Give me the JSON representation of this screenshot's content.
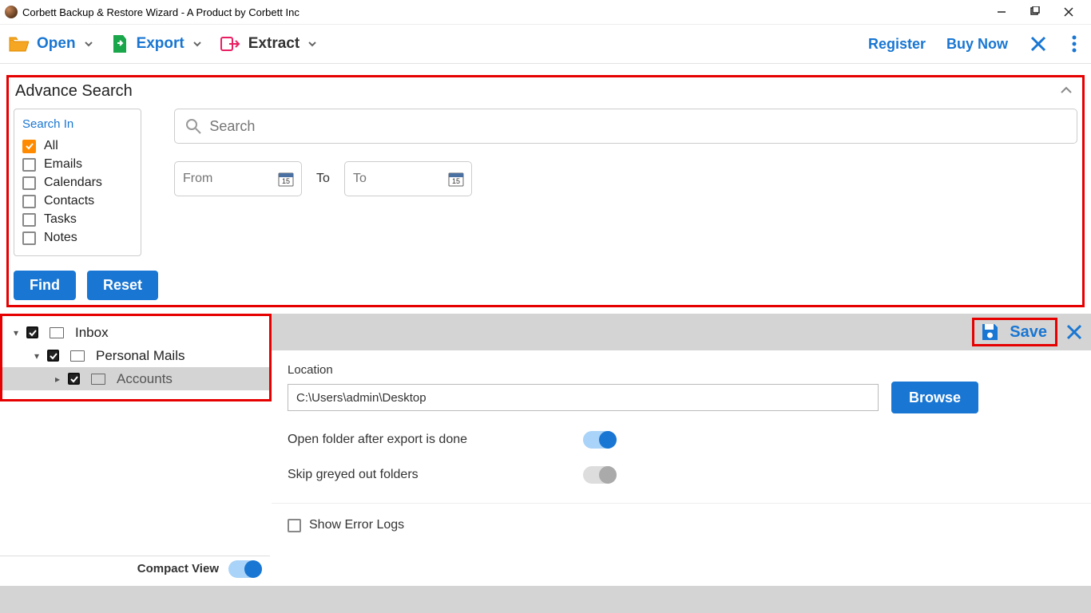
{
  "window": {
    "title": "Corbett Backup & Restore Wizard - A Product by Corbett Inc"
  },
  "toolbar": {
    "open": "Open",
    "export": "Export",
    "extract": "Extract",
    "register": "Register",
    "buynow": "Buy Now"
  },
  "advsearch": {
    "title": "Advance Search",
    "searchin_title": "Search In",
    "items": [
      {
        "label": "All",
        "checked": true
      },
      {
        "label": "Emails",
        "checked": false
      },
      {
        "label": "Calendars",
        "checked": false
      },
      {
        "label": "Contacts",
        "checked": false
      },
      {
        "label": "Tasks",
        "checked": false
      },
      {
        "label": "Notes",
        "checked": false
      }
    ],
    "search_placeholder": "Search",
    "from_placeholder": "From",
    "to_label": "To",
    "to_placeholder": "To",
    "find": "Find",
    "reset": "Reset"
  },
  "tree": {
    "items": [
      {
        "label": "Inbox",
        "indent": 0,
        "checked": true,
        "expanded": true,
        "selected": false
      },
      {
        "label": "Personal Mails",
        "indent": 1,
        "checked": true,
        "expanded": true,
        "selected": false
      },
      {
        "label": "Accounts",
        "indent": 2,
        "checked": true,
        "expanded": false,
        "selected": true
      }
    ]
  },
  "compact": {
    "label": "Compact View",
    "on": true
  },
  "savebar": {
    "save": "Save"
  },
  "form": {
    "location_label": "Location",
    "location_value": "C:\\Users\\admin\\Desktop",
    "browse": "Browse",
    "open_after": "Open folder after export is done",
    "open_after_on": true,
    "skip_greyed": "Skip greyed out folders",
    "skip_greyed_on": false,
    "show_error_logs": "Show Error Logs"
  }
}
